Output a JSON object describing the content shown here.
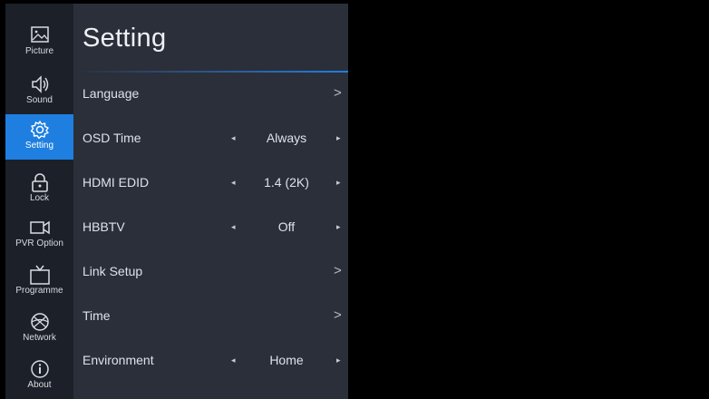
{
  "sidebar": {
    "items": [
      {
        "label": "Picture",
        "icon": "picture-icon",
        "active": false
      },
      {
        "label": "Sound",
        "icon": "sound-icon",
        "active": false
      },
      {
        "label": "Setting",
        "icon": "gear-icon",
        "active": true
      },
      {
        "label": "Lock",
        "icon": "lock-icon",
        "active": false
      },
      {
        "label": "PVR Option",
        "icon": "record-icon",
        "active": false
      },
      {
        "label": "Programme",
        "icon": "tv-icon",
        "active": false
      },
      {
        "label": "Network",
        "icon": "globe-icon",
        "active": false
      },
      {
        "label": "About",
        "icon": "info-icon",
        "active": false
      }
    ]
  },
  "main": {
    "title": "Setting",
    "rows": [
      {
        "label": "Language",
        "type": "submenu",
        "chevron": ">"
      },
      {
        "label": "OSD Time",
        "type": "selector",
        "value": "Always",
        "left_arrow": "◂",
        "right_arrow": "▸"
      },
      {
        "label": "HDMI EDID",
        "type": "selector",
        "value": "1.4 (2K)",
        "left_arrow": "◂",
        "right_arrow": "▸"
      },
      {
        "label": "HBBTV",
        "type": "selector",
        "value": "Off",
        "left_arrow": "◂",
        "right_arrow": "▸"
      },
      {
        "label": "Link Setup",
        "type": "submenu",
        "chevron": ">"
      },
      {
        "label": "Time",
        "type": "submenu",
        "chevron": ">"
      },
      {
        "label": "Environment",
        "type": "selector",
        "value": "Home",
        "left_arrow": "◂",
        "right_arrow": "▸"
      }
    ]
  },
  "colors": {
    "active": "#1f7fe0",
    "panel": "#2a2f3a",
    "sidebar": "#1c2028"
  }
}
